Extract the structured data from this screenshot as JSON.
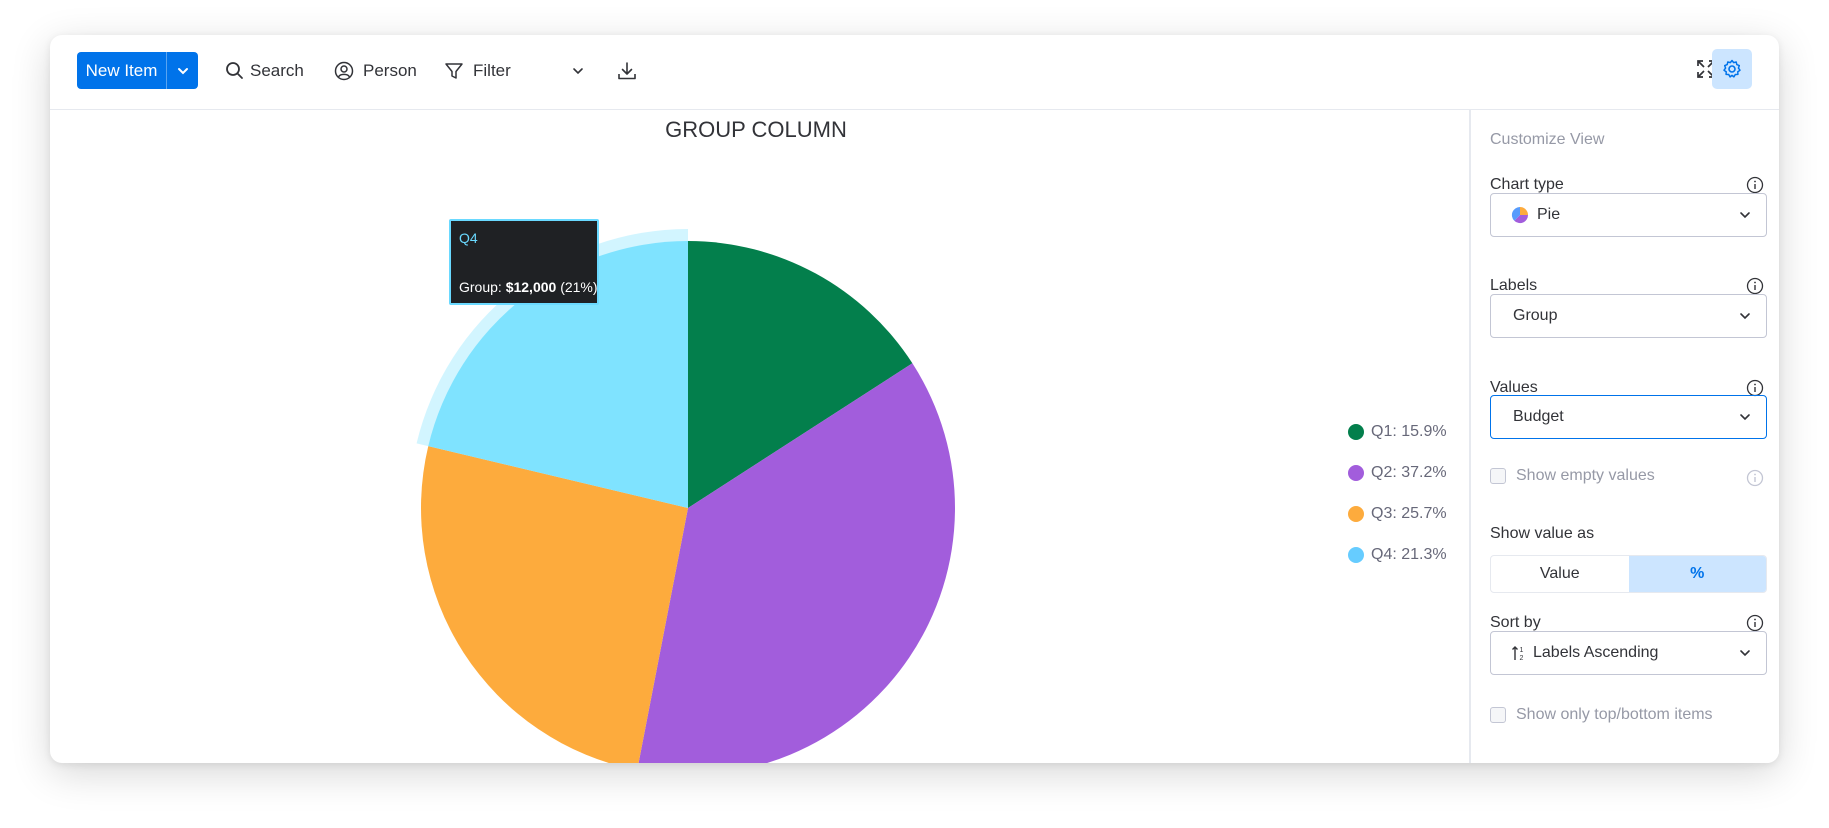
{
  "toolbar": {
    "new_item_label": "New Item",
    "search_label": "Search",
    "person_label": "Person",
    "filter_label": "Filter"
  },
  "tooltip": {
    "label": "Q4",
    "prefix": "Group: ",
    "value": "$12,000",
    "percent": " (21%)"
  },
  "sidebar": {
    "title": "Customize View",
    "chart_type_label": "Chart type",
    "chart_type_value": "Pie",
    "labels_label": "Labels",
    "labels_value": "Group",
    "values_label": "Values",
    "values_value": "Budget",
    "show_empty_label": "Show empty values",
    "show_value_as_label": "Show value as",
    "show_value_as_options": [
      "Value",
      "%"
    ],
    "show_value_as_selected": "%",
    "sort_by_label": "Sort by",
    "sort_by_value": "Labels Ascending",
    "top_bottom_label": "Show only top/bottom items"
  },
  "chart_data": {
    "type": "pie",
    "title": "GROUP COLUMN",
    "categories": [
      "Q1",
      "Q2",
      "Q3",
      "Q4"
    ],
    "values": [
      15.9,
      37.2,
      25.7,
      21.3
    ],
    "legend": [
      "Q1: 15.9%",
      "Q2: 37.2%",
      "Q3: 25.7%",
      "Q4: 21.3%"
    ],
    "colors": [
      "#037f4c",
      "#a25ddc",
      "#fdab3d",
      "#7fe3ff"
    ],
    "legend_colors": [
      "#037f4c",
      "#a25ddc",
      "#fdab3d",
      "#66ccff"
    ],
    "highlighted": "Q4",
    "legend_position": "right"
  }
}
